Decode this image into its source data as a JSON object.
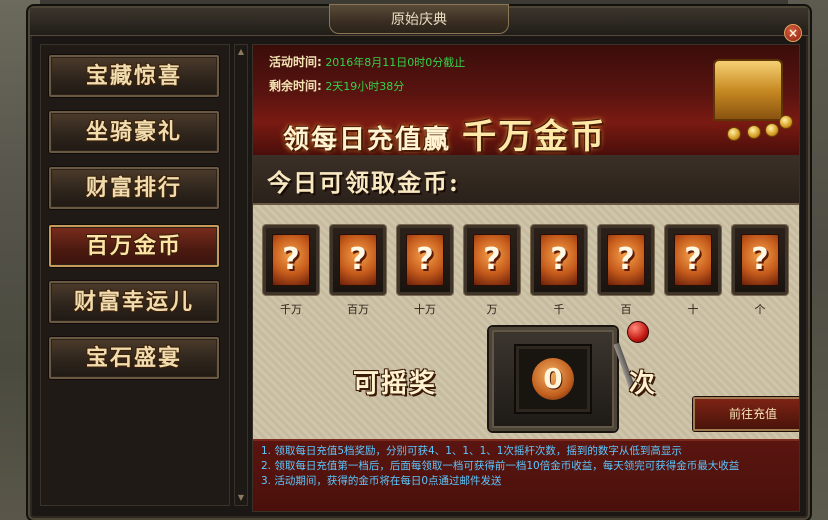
{
  "window": {
    "title": "原始庆典",
    "close_label": "×"
  },
  "sidebar": {
    "items": [
      {
        "label": "宝藏惊喜",
        "active": false
      },
      {
        "label": "坐骑豪礼",
        "active": false
      },
      {
        "label": "财富排行",
        "active": false
      },
      {
        "label": "百万金币",
        "active": true
      },
      {
        "label": "财富幸运儿",
        "active": false
      },
      {
        "label": "宝石盛宴",
        "active": false
      }
    ]
  },
  "banner": {
    "activity_time_label": "活动时间:",
    "activity_time_value": "2016年8月11日0时0分截止",
    "remaining_label": "剩余时间:",
    "remaining_value": "2天19小时38分",
    "title_prefix": "领每日充值赢",
    "title_highlight": "千万金币"
  },
  "today": {
    "title": "今日可领取金币:"
  },
  "cards": [
    {
      "symbol": "?",
      "label": "千万"
    },
    {
      "symbol": "?",
      "label": "百万"
    },
    {
      "symbol": "?",
      "label": "十万"
    },
    {
      "symbol": "?",
      "label": "万"
    },
    {
      "symbol": "?",
      "label": "千"
    },
    {
      "symbol": "?",
      "label": "百"
    },
    {
      "symbol": "?",
      "label": "十"
    },
    {
      "symbol": "?",
      "label": "个"
    }
  ],
  "slot": {
    "prefix": "可摇奖",
    "count": "0",
    "suffix": "次"
  },
  "recharge_button": "前往充值",
  "notes": [
    "1. 领取每日充值5档奖励，分别可获4、1、1、1、1次摇杆次数，摇到的数字从低到高显示",
    "2. 领取每日充值第一档后，后面每领取一档可获得前一档10倍金币收益，每天领完可获得金币最大收益",
    "3. 活动期间，获得的金币将在每日0点通过邮件发送"
  ],
  "colors": {
    "accent_red": "#7a1a12",
    "info_green": "#35d24a",
    "note_blue": "#5cc7ff",
    "gold": "#f1dcae"
  }
}
